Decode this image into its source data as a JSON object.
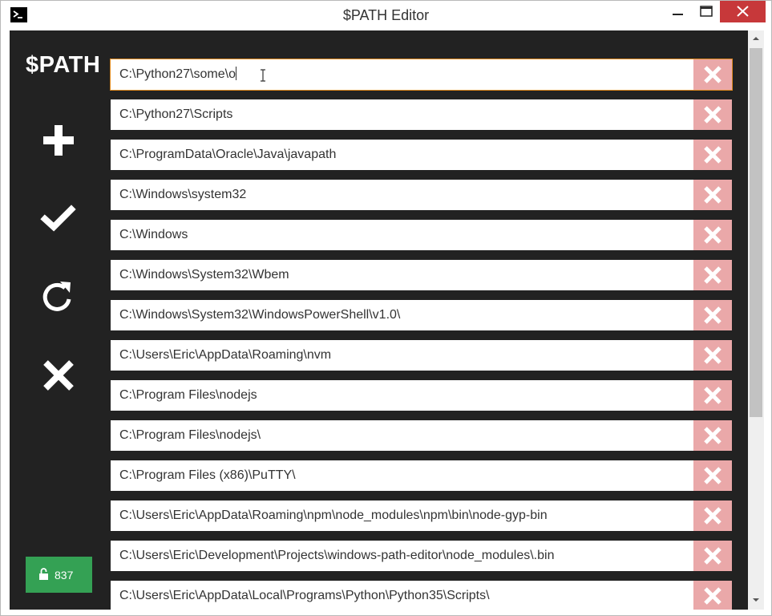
{
  "window": {
    "title": "$PATH Editor"
  },
  "sidebar": {
    "logo": "$PATH",
    "add_icon": "plus-icon",
    "save_icon": "check-icon",
    "reload_icon": "reload-icon",
    "cancel_icon": "x-icon",
    "count": "837",
    "count_icon": "unlocked-icon"
  },
  "colors": {
    "background": "#222222",
    "delete_button": "#eaa8a9",
    "count_badge": "#34a154",
    "close_button": "#c7383a",
    "edit_outline": "#e08a1e"
  },
  "paths": [
    "C:\\Python27\\some\\o",
    "C:\\Python27\\Scripts",
    "C:\\ProgramData\\Oracle\\Java\\javapath",
    "C:\\Windows\\system32",
    "C:\\Windows",
    "C:\\Windows\\System32\\Wbem",
    "C:\\Windows\\System32\\WindowsPowerShell\\v1.0\\",
    "C:\\Users\\Eric\\AppData\\Roaming\\nvm",
    "C:\\Program Files\\nodejs",
    "C:\\Program Files\\nodejs\\",
    "C:\\Program Files (x86)\\PuTTY\\",
    "C:\\Users\\Eric\\AppData\\Roaming\\npm\\node_modules\\npm\\bin\\node-gyp-bin",
    "C:\\Users\\Eric\\Development\\Projects\\windows-path-editor\\node_modules\\.bin",
    "C:\\Users\\Eric\\AppData\\Local\\Programs\\Python\\Python35\\Scripts\\"
  ]
}
